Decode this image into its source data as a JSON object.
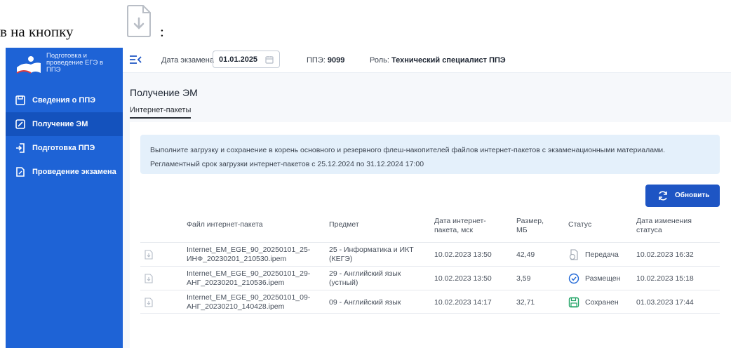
{
  "doc": {
    "text_before": "в на кнопку",
    "text_after": ":",
    "icon": "file-download-icon"
  },
  "sidebar": {
    "brand": "Подготовка и проведение ЕГЭ в ППЭ",
    "items": [
      {
        "label": "Сведения о ППЭ",
        "icon": "save-icon"
      },
      {
        "label": "Получение ЭМ",
        "icon": "edit-document-icon"
      },
      {
        "label": "Подготовка ППЭ",
        "icon": "login-icon"
      },
      {
        "label": "Проведение экзамена",
        "icon": "document-icon"
      }
    ],
    "active_index": 1
  },
  "header": {
    "menu_icon": "menu-collapse-icon",
    "exam_date_label": "Дата экзамена",
    "exam_date_value": "01.01.2025",
    "ppe_label": "ППЭ:",
    "ppe_value": "9099",
    "role_label": "Роль:",
    "role_value": "Технический специалист ППЭ"
  },
  "main": {
    "title": "Получение ЭМ",
    "tab": "Интернет-пакеты",
    "info_line1": "Выполните загрузку и сохранение в корень основного и резервного флеш-накопителей файлов интернет-пакетов с экзаменационными материалами.",
    "info_line2": "Регламентный срок загрузки интернет-пакетов с 25.12.2024 по 31.12.2024 17:00",
    "refresh_label": "Обновить"
  },
  "table": {
    "columns": [
      "Файл интернет-пакета",
      "Предмет",
      "Дата интернет-пакета, мск",
      "Размер, МБ",
      "Статус",
      "Дата изменения статуса"
    ],
    "rows": [
      {
        "file": "Internet_EM_EGE_90_20250101_25-ИНФ_20230201_210530.ipem",
        "subject": "25 - Информатика и ИКТ (КЕГЭ)",
        "date": "10.02.2023 13:50",
        "size": "42,49",
        "status": "Передача",
        "status_icon": "transfer-icon",
        "changed": "10.02.2023 16:32"
      },
      {
        "file": "Internet_EM_EGE_90_20250101_29-АНГ_20230201_210536.ipem",
        "subject": "29 - Английский язык (устный)",
        "date": "10.02.2023 13:50",
        "size": "3,59",
        "status": "Размещен",
        "status_icon": "check-circle-icon",
        "changed": "10.02.2023 15:18"
      },
      {
        "file": "Internet_EM_EGE_90_20250101_09-АНГ_20230210_140428.ipem",
        "subject": "09 - Английский язык",
        "date": "10.02.2023 14:17",
        "size": "32,71",
        "status": "Сохранен",
        "status_icon": "save-icon",
        "changed": "01.03.2023 17:44"
      }
    ]
  },
  "colors": {
    "sidebar": "#1e63d6",
    "primary_button": "#1e55c4",
    "info_bg": "#e4f0fb",
    "status_ok": "#1e66d6",
    "status_saved": "#21a366"
  }
}
